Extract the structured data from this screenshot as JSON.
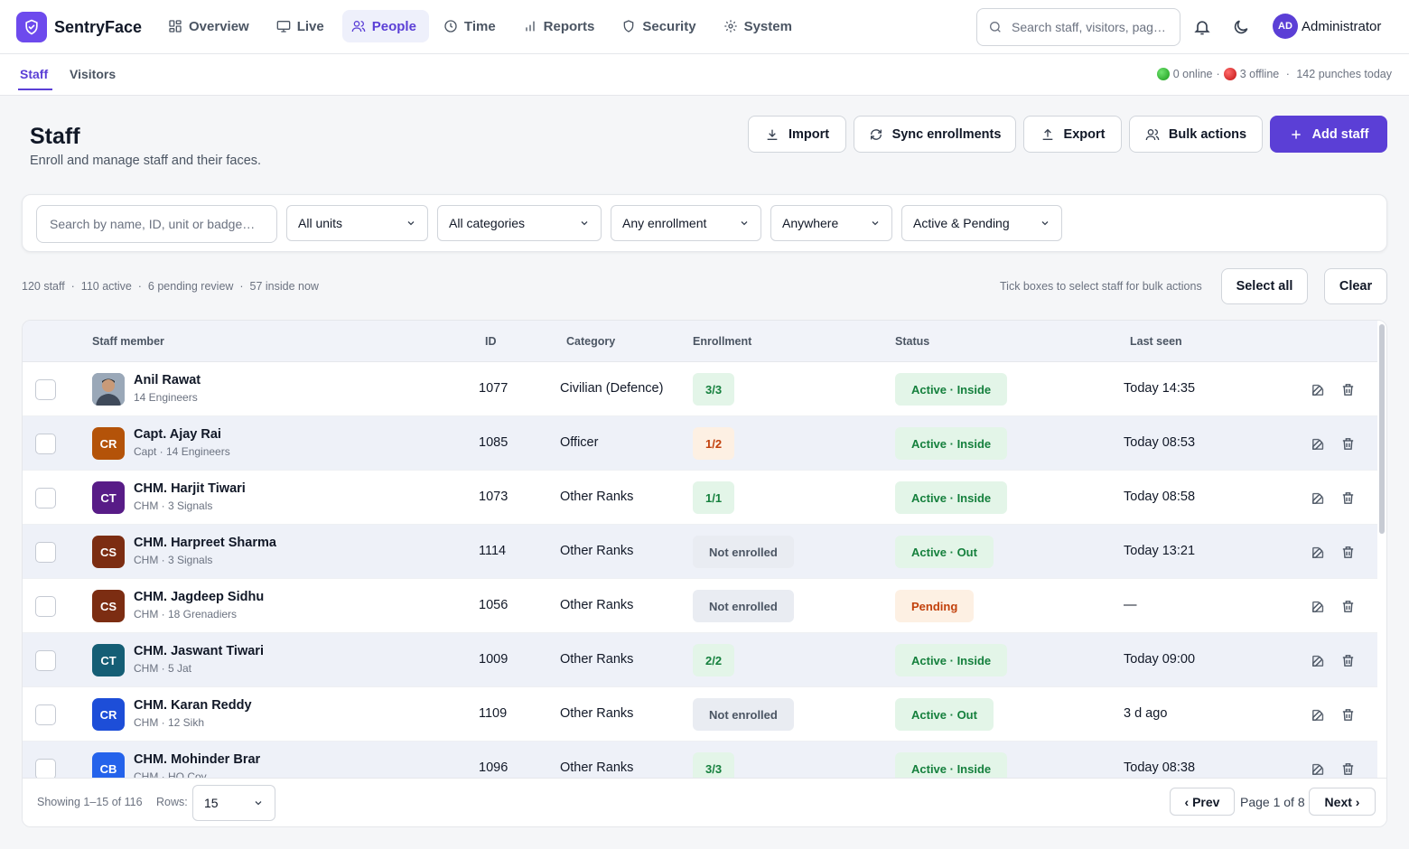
{
  "app": {
    "name": "SentryFace"
  },
  "nav": [
    {
      "label": "Overview",
      "icon": "grid-icon"
    },
    {
      "label": "Live",
      "icon": "monitor-icon"
    },
    {
      "label": "People",
      "icon": "users-icon",
      "active": true
    },
    {
      "label": "Time",
      "icon": "clock-icon"
    },
    {
      "label": "Reports",
      "icon": "bar-chart-icon"
    },
    {
      "label": "Security",
      "icon": "shield-icon"
    },
    {
      "label": "System",
      "icon": "gear-icon"
    }
  ],
  "search": {
    "placeholder": "Search staff, visitors, pag…"
  },
  "user": {
    "initials": "AD",
    "name": "Administrator"
  },
  "subnav": {
    "tabs": [
      "Staff",
      "Visitors"
    ],
    "online": "0 online",
    "offline": "3 offline",
    "punches": "142 punches today"
  },
  "page": {
    "title": "Staff",
    "subtitle": "Enroll and manage staff and their faces.",
    "actions": {
      "import": "Import",
      "sync": "Sync enrollments",
      "export": "Export",
      "bulk": "Bulk actions",
      "add": "Add staff"
    }
  },
  "filters": {
    "search_placeholder": "Search by name, ID, unit or badge…",
    "units": "All units",
    "categories": "All categories",
    "enrollment": "Any enrollment",
    "location": "Anywhere",
    "status": "Active & Pending"
  },
  "summary": {
    "total": "120 staff",
    "active": "110 active",
    "pending": "6 pending review",
    "inside": "57 inside now",
    "hint": "Tick boxes to select staff for bulk actions",
    "select_all": "Select all",
    "clear": "Clear"
  },
  "table": {
    "columns": {
      "member": "Staff member",
      "id": "ID",
      "category": "Category",
      "enrollment": "Enrollment",
      "status": "Status",
      "last_seen": "Last seen"
    },
    "rows": [
      {
        "initials": "",
        "photo": true,
        "color": "#8a9bb0",
        "name": "Anil Rawat",
        "sub": "14 Engineers",
        "id": "1077",
        "category": "Civilian (Defence)",
        "enrollment": "3/3",
        "enroll_kind": "ok",
        "status": "Active · Inside",
        "status_kind": "active",
        "last_seen": "Today 14:35"
      },
      {
        "initials": "CR",
        "color": "#b45309",
        "name": "Capt. Ajay Rai",
        "sub": "Capt · 14 Engineers",
        "id": "1085",
        "category": "Officer",
        "enrollment": "1/2",
        "enroll_kind": "partial",
        "status": "Active · Inside",
        "status_kind": "active",
        "last_seen": "Today 08:53"
      },
      {
        "initials": "CT",
        "color": "#581c87",
        "name": "CHM. Harjit Tiwari",
        "sub": "CHM · 3 Signals",
        "id": "1073",
        "category": "Other Ranks",
        "enrollment": "1/1",
        "enroll_kind": "ok",
        "status": "Active · Inside",
        "status_kind": "active",
        "last_seen": "Today 08:58"
      },
      {
        "initials": "CS",
        "color": "#7c2d12",
        "name": "CHM. Harpreet Sharma",
        "sub": "CHM · 3 Signals",
        "id": "1114",
        "category": "Other Ranks",
        "enrollment": "Not enrolled",
        "enroll_kind": "none",
        "status": "Active · Out",
        "status_kind": "active",
        "last_seen": "Today 13:21"
      },
      {
        "initials": "CS",
        "color": "#7c2d12",
        "name": "CHM. Jagdeep Sidhu",
        "sub": "CHM · 18 Grenadiers",
        "id": "1056",
        "category": "Other Ranks",
        "enrollment": "Not enrolled",
        "enroll_kind": "none",
        "status": "Pending",
        "status_kind": "pending",
        "last_seen": "—"
      },
      {
        "initials": "CT",
        "color": "#155e75",
        "name": "CHM. Jaswant Tiwari",
        "sub": "CHM · 5 Jat",
        "id": "1009",
        "category": "Other Ranks",
        "enrollment": "2/2",
        "enroll_kind": "ok",
        "status": "Active · Inside",
        "status_kind": "active",
        "last_seen": "Today 09:00"
      },
      {
        "initials": "CR",
        "color": "#1d4ed8",
        "name": "CHM. Karan Reddy",
        "sub": "CHM · 12 Sikh",
        "id": "1109",
        "category": "Other Ranks",
        "enrollment": "Not enrolled",
        "enroll_kind": "none",
        "status": "Active · Out",
        "status_kind": "active",
        "last_seen": "3 d ago"
      },
      {
        "initials": "CB",
        "color": "#2563eb",
        "name": "CHM. Mohinder Brar",
        "sub": "CHM · HQ Coy",
        "id": "1096",
        "category": "Other Ranks",
        "enrollment": "3/3",
        "enroll_kind": "ok",
        "status": "Active · Inside",
        "status_kind": "active",
        "last_seen": "Today 08:38"
      }
    ]
  },
  "footer": {
    "showing": "Showing 1–15 of 116",
    "rows_label": "Rows:",
    "rows_value": "15",
    "prev": "‹ Prev",
    "page": "Page 1 of 8",
    "next": "Next ›"
  },
  "colors": {
    "accent": "#5b3fd6",
    "success_bg": "#e3f5e8",
    "success_text": "#15803d",
    "warn_bg": "#fdf0e3",
    "warn_text": "#c2410c"
  }
}
